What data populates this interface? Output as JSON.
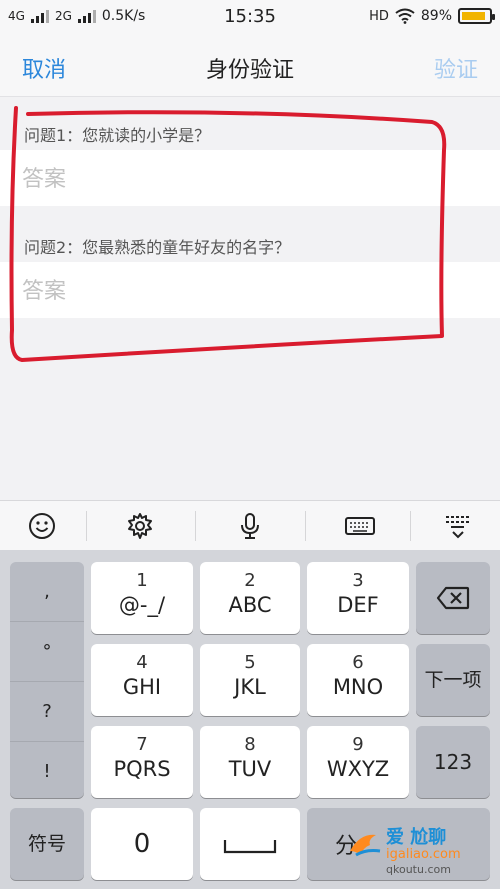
{
  "status_bar": {
    "network_1": "4G",
    "network_2": "2G",
    "speed": "0.5K/s",
    "time": "15:35",
    "hd": "HD",
    "battery": "89%",
    "battery_level": 0.89
  },
  "nav": {
    "cancel": "取消",
    "title": "身份验证",
    "verify": "验证"
  },
  "questions": [
    {
      "label": "问题1：您就读的小学是？",
      "placeholder": "答案"
    },
    {
      "label": "问题2：您最熟悉的童年好友的名字？",
      "placeholder": "答案"
    }
  ],
  "keyboard": {
    "punct": [
      ",",
      "°",
      "?",
      "!"
    ],
    "rows": [
      [
        {
          "num": "1",
          "letters": "@-_/"
        },
        {
          "num": "2",
          "letters": "ABC"
        },
        {
          "num": "3",
          "letters": "DEF"
        }
      ],
      [
        {
          "num": "4",
          "letters": "GHI"
        },
        {
          "num": "5",
          "letters": "JKL"
        },
        {
          "num": "6",
          "letters": "MNO"
        }
      ],
      [
        {
          "num": "7",
          "letters": "PQRS"
        },
        {
          "num": "8",
          "letters": "TUV"
        },
        {
          "num": "9",
          "letters": "WXYZ"
        }
      ]
    ],
    "next": "下一项",
    "num_switch": "123",
    "symbols": "符号",
    "zero": "0",
    "partial_key": "分"
  },
  "watermark": {
    "brand_line": "爱 尬聊",
    "url": "igaliao.com",
    "url2": "qkoutu.com"
  },
  "colors": {
    "accent": "#2c87db",
    "disabled_accent": "#a9ccf0",
    "annotation_red": "#d91c2e"
  }
}
